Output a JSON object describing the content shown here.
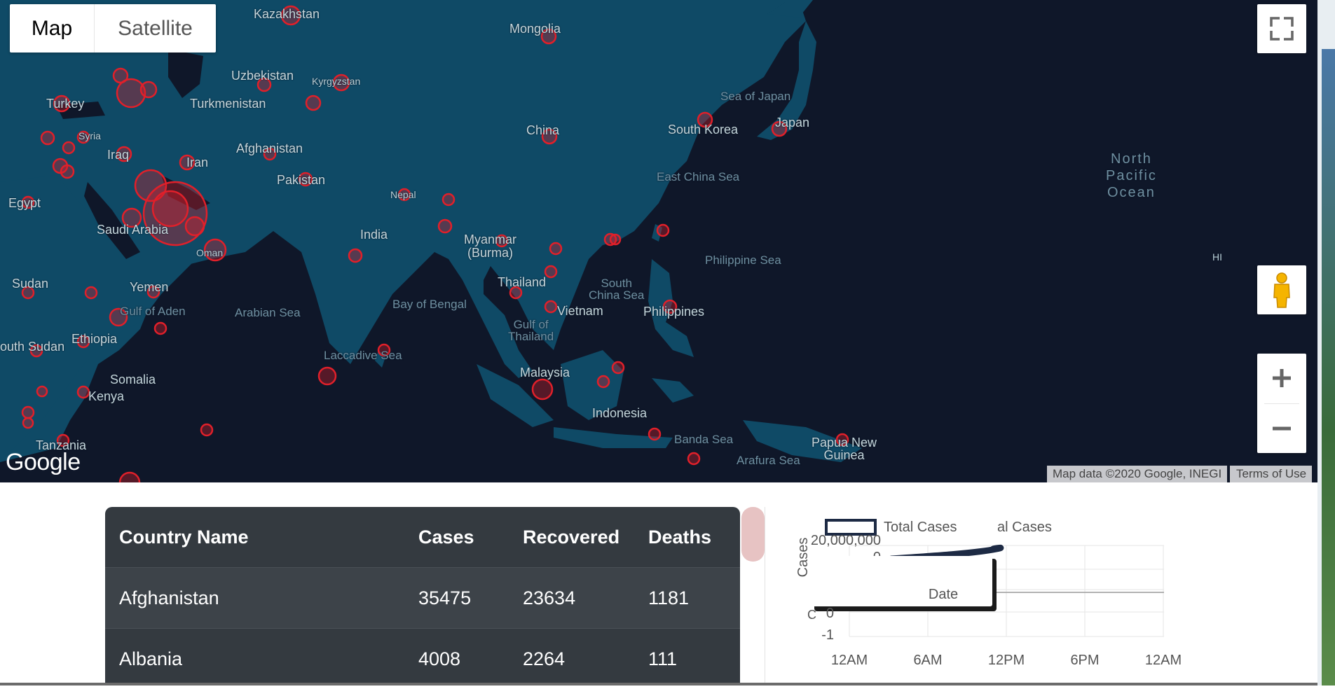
{
  "map": {
    "type_controls": {
      "map_label": "Map",
      "satellite_label": "Satellite"
    },
    "attribution": {
      "map_data": "Map data ©2020 Google, INEGI",
      "terms": "Terms of Use"
    },
    "logo": "Google",
    "labels": {
      "kazakhstan": "Kazakhstan",
      "mongolia": "Mongolia",
      "uzbekistan": "Uzbekistan",
      "kyrgyzstan": "Kyrgyzstan",
      "turkey": "Turkey",
      "turkmenistan": "Turkmenistan",
      "syria": "Syria",
      "iraq": "Iraq",
      "iran": "Iran",
      "afghanistan": "Afghanistan",
      "china": "China",
      "sea_of_japan": "Sea of Japan",
      "south_korea": "South Korea",
      "japan": "Japan",
      "egypt": "Egypt",
      "pakistan": "Pakistan",
      "nepal": "Nepal",
      "saudi_arabia": "Saudi Arabia",
      "east_china_sea": "East China Sea",
      "north_pacific": "North\nPacific\nOcean",
      "india": "India",
      "myanmar": "Myanmar\n(Burma)",
      "oman": "Oman",
      "sudan": "Sudan",
      "yemen": "Yemen",
      "thailand": "Thailand",
      "philippine_sea": "Philippine Sea",
      "hi": "HI",
      "south_china_sea": "South\nChina Sea",
      "gulf_of_aden": "Gulf of Aden",
      "arabian_sea": "Arabian Sea",
      "bay_of_bengal": "Bay of Bengal",
      "vietnam": "Vietnam",
      "philippines": "Philippines",
      "gulf_of_thailand": "Gulf of\nThailand",
      "south_sudan": "outh Sudan",
      "ethiopia": "Ethiopia",
      "laccadive_sea": "Laccadive Sea",
      "somalia": "Somalia",
      "malaysia": "Malaysia",
      "kenya": "Kenya",
      "indonesia": "Indonesia",
      "tanzania": "Tanzania",
      "banda_sea": "Banda Sea",
      "papua": "Papua New\nGuinea",
      "arafura_sea": "Arafura Sea"
    }
  },
  "table": {
    "headers": [
      "Country Name",
      "Cases",
      "Recovered",
      "Deaths"
    ],
    "rows": [
      [
        "Afghanistan",
        "35475",
        "23634",
        "1181"
      ],
      [
        "Albania",
        "4008",
        "2264",
        "111"
      ]
    ]
  },
  "chart": {
    "legend_1": "Total Cases",
    "legend_2_partial": "al Cases",
    "ylabel": "Cases",
    "ytick_top": "20,000,000",
    "ytick_zero": "0",
    "xlabel": "Date",
    "lower_y_ticks": [
      "0",
      "-1"
    ],
    "x_ticks": [
      "12AM",
      "6AM",
      "12PM",
      "6PM",
      "12AM"
    ]
  }
}
